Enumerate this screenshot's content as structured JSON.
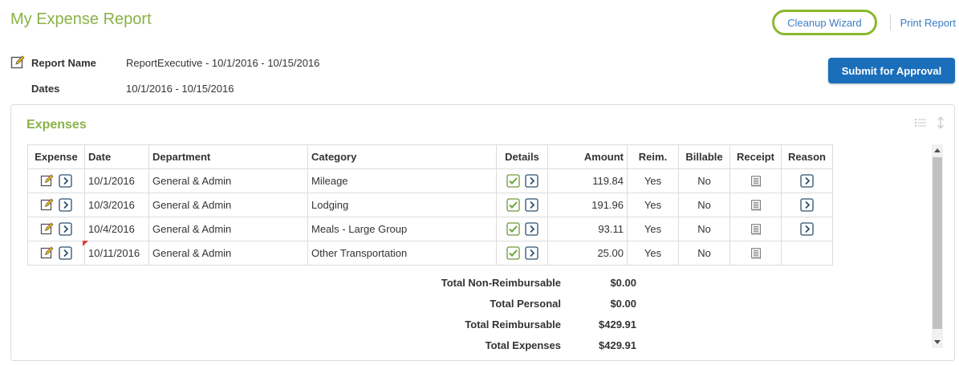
{
  "header": {
    "title": "My Expense Report",
    "cleanup_wizard": "Cleanup Wizard",
    "print_report": "Print Report",
    "submit": "Submit for Approval"
  },
  "report": {
    "name_label": "Report Name",
    "name_value": "ReportExecutive - 10/1/2016 - 10/15/2016",
    "dates_label": "Dates",
    "dates_value": "10/1/2016 - 10/15/2016"
  },
  "expenses": {
    "title": "Expenses",
    "columns": [
      "Expense",
      "Date",
      "Department",
      "Category",
      "Details",
      "Amount",
      "Reim.",
      "Billable",
      "Receipt",
      "Reason"
    ],
    "rows": [
      {
        "date": "10/1/2016",
        "department": "General & Admin",
        "category": "Mileage",
        "amount": "119.84",
        "reim": "Yes",
        "billable": "No",
        "has_reason": true,
        "flagged": false
      },
      {
        "date": "10/3/2016",
        "department": "General & Admin",
        "category": "Lodging",
        "amount": "191.96",
        "reim": "Yes",
        "billable": "No",
        "has_reason": true,
        "flagged": false
      },
      {
        "date": "10/4/2016",
        "department": "General & Admin",
        "category": "Meals - Large Group",
        "amount": "93.11",
        "reim": "Yes",
        "billable": "No",
        "has_reason": true,
        "flagged": false
      },
      {
        "date": "10/11/2016",
        "department": "General & Admin",
        "category": "Other Transportation",
        "amount": "25.00",
        "reim": "Yes",
        "billable": "No",
        "has_reason": false,
        "flagged": true
      }
    ],
    "totals": [
      {
        "label": "Total Non-Reimbursable",
        "value": "$0.00"
      },
      {
        "label": "Total Personal",
        "value": "$0.00"
      },
      {
        "label": "Total Reimbursable",
        "value": "$429.91"
      },
      {
        "label": "Total Expenses",
        "value": "$429.91"
      }
    ]
  },
  "colors": {
    "accent_green": "#8ab245",
    "link_blue": "#3b7dc4",
    "primary_button": "#1b6fba",
    "flag_red": "#e53935"
  },
  "icons": {
    "edit": "edit-icon",
    "open": "chevron-right-icon",
    "checked": "checkbox-checked-icon",
    "receipt": "receipt-icon",
    "list_view": "list-view-icon",
    "resize": "resize-vertical-icon"
  }
}
